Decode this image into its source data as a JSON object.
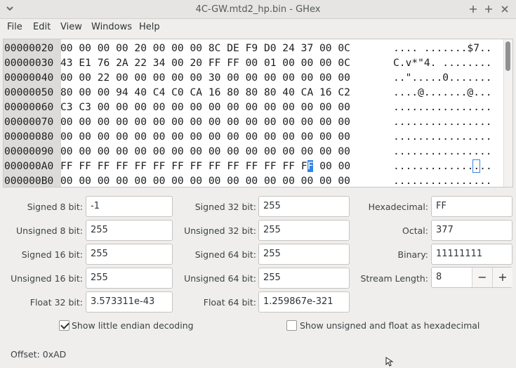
{
  "window": {
    "title": "4C-GW.mtd2_hp.bin - GHex",
    "minimize_icon": "+",
    "maximize_icon": "+",
    "close_icon": "✕"
  },
  "menu": [
    "File",
    "Edit",
    "View",
    "Windows",
    "Help"
  ],
  "hex_rows": [
    {
      "offset": "00000020",
      "hex": "00 00 00 00 20 00 00 00 8C DE F9 D0 24 37 00 0C",
      "ascii": ".... .......$7.."
    },
    {
      "offset": "00000030",
      "hex": "43 E1 76 2A 22 34 00 20 FF FF 00 01 00 00 00 0C",
      "ascii": "C.v*\"4. ........"
    },
    {
      "offset": "00000040",
      "hex": "00 00 22 00 00 00 00 00 30 00 00 00 00 00 00 00",
      "ascii": "..\".....0......."
    },
    {
      "offset": "00000050",
      "hex": "80 00 00 94 40 C4 C0 CA 16 80 80 80 40 CA 16 C2",
      "ascii": "....@.......@..."
    },
    {
      "offset": "00000060",
      "hex": "C3 C3 00 00 00 00 00 00 00 00 00 00 00 00 00 00",
      "ascii": "................"
    },
    {
      "offset": "00000070",
      "hex": "00 00 00 00 00 00 00 00 00 00 00 00 00 00 00 00",
      "ascii": "................"
    },
    {
      "offset": "00000080",
      "hex": "00 00 00 00 00 00 00 00 00 00 00 00 00 00 00 00",
      "ascii": "................"
    },
    {
      "offset": "00000090",
      "hex": "00 00 00 00 00 00 00 00 00 00 00 00 00 00 00 00",
      "ascii": "................"
    },
    {
      "offset": "000000A0",
      "hex": "FF FF FF FF FF FF FF FF FF FF FF FF FF FF 00 00",
      "ascii": "................"
    },
    {
      "offset": "000000B0",
      "hex": "00 00 00 00 00 00 00 00 00 00 00 00 00 00 00 00",
      "ascii": "................"
    }
  ],
  "selection": {
    "row_index": 8,
    "byte_index": 13,
    "nibble_selected": "F"
  },
  "converter": {
    "signed_8": {
      "label": "Signed 8 bit:",
      "value": "-1"
    },
    "unsigned_8": {
      "label": "Unsigned 8 bit:",
      "value": "255"
    },
    "signed_16": {
      "label": "Signed 16 bit:",
      "value": "255"
    },
    "unsigned_16": {
      "label": "Unsigned 16 bit:",
      "value": "255"
    },
    "float_32": {
      "label": "Float 32 bit:",
      "value": "3.573311e-43"
    },
    "signed_32": {
      "label": "Signed 32 bit:",
      "value": "255"
    },
    "unsigned_32": {
      "label": "Unsigned 32 bit:",
      "value": "255"
    },
    "signed_64": {
      "label": "Signed 64 bit:",
      "value": "255"
    },
    "unsigned_64": {
      "label": "Unsigned 64 bit:",
      "value": "255"
    },
    "float_64": {
      "label": "Float 64 bit:",
      "value": "1.259867e-321"
    },
    "hexadecimal": {
      "label": "Hexadecimal:",
      "value": "FF"
    },
    "octal": {
      "label": "Octal:",
      "value": "377"
    },
    "binary": {
      "label": "Binary:",
      "value": "11111111"
    },
    "stream_length": {
      "label": "Stream Length:",
      "value": "8",
      "minus": "−",
      "plus": "+"
    }
  },
  "options": {
    "little_endian": {
      "label": "Show little endian decoding",
      "checked": true
    },
    "unsigned_hex": {
      "label": "Show unsigned and float as hexadecimal",
      "checked": false
    }
  },
  "status": {
    "offset_text": "Offset: 0xAD"
  },
  "colors": {
    "selection": "#3584e4",
    "offset_column": "#dcdbd9"
  }
}
